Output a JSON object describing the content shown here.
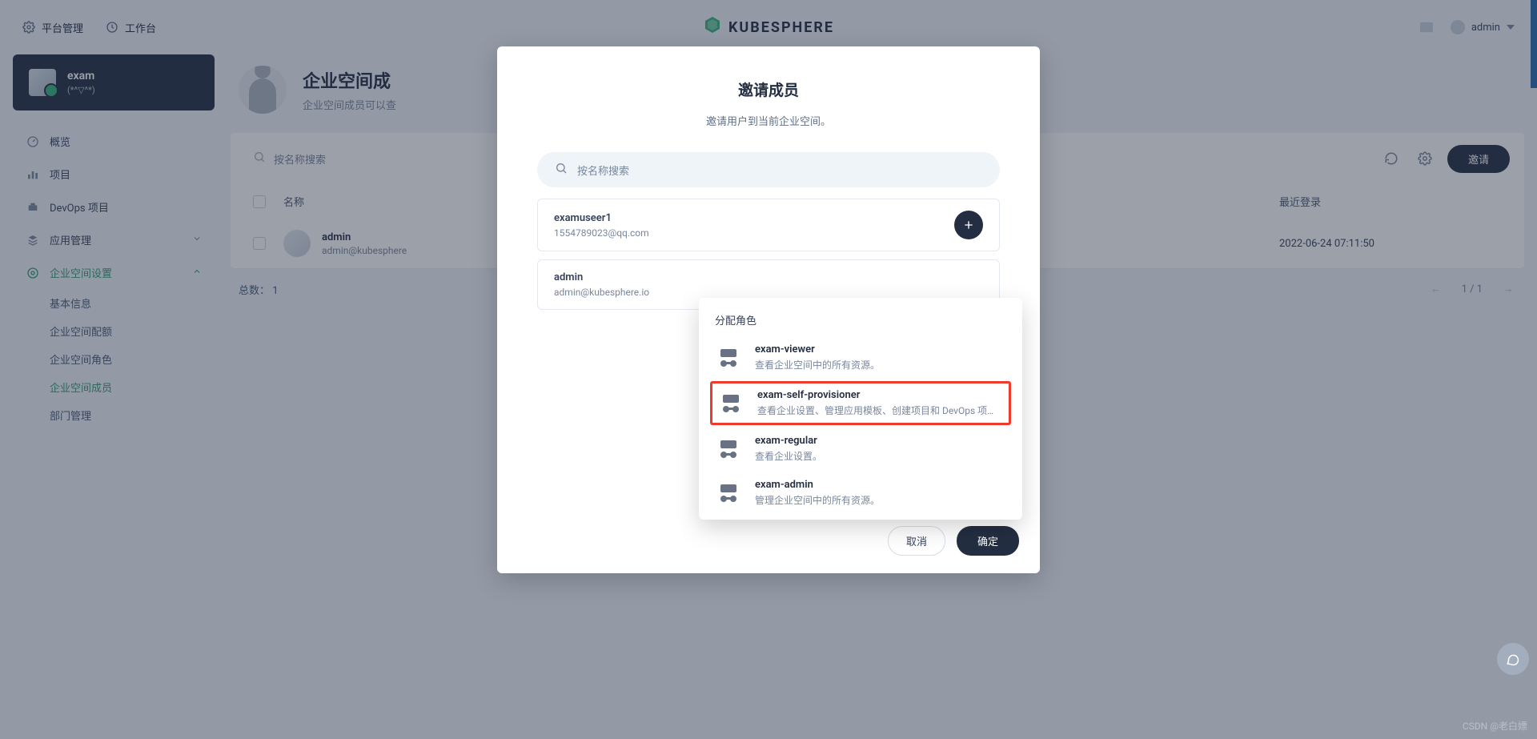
{
  "header": {
    "platform": "平台管理",
    "workbench": "工作台",
    "logo_text": "KUBESPHERE",
    "user": "admin"
  },
  "workspace": {
    "name": "exam",
    "desc": "(*^▽^*)"
  },
  "nav": {
    "overview": "概览",
    "projects": "项目",
    "devops": "DevOps 项目",
    "app_mgmt": "应用管理",
    "ws_settings": "企业空间设置",
    "sub": {
      "basic": "基本信息",
      "quota": "企业空间配额",
      "roles": "企业空间角色",
      "members": "企业空间成员",
      "dept": "部门管理"
    }
  },
  "page": {
    "title": "企业空间成",
    "subtitle": "企业空间成员可以查"
  },
  "toolbar": {
    "search_placeholder": "按名称搜索",
    "invite": "邀请"
  },
  "table": {
    "col_name": "名称",
    "col_last_login": "最近登录",
    "rows": [
      {
        "name": "admin",
        "email": "admin@kubesphere",
        "last_login": "2022-06-24 07:11:50"
      }
    ],
    "total_label": "总数：",
    "total": 1,
    "page_info": "1 / 1"
  },
  "modal": {
    "title": "邀请成员",
    "subtitle": "邀请用户到当前企业空间。",
    "search_placeholder": "按名称搜索",
    "users": [
      {
        "name": "examuseer1",
        "email": "1554789023@qq.com"
      },
      {
        "name": "admin",
        "email": "admin@kubesphere.io"
      }
    ],
    "role_popup_title": "分配角色",
    "roles": [
      {
        "name": "exam-viewer",
        "desc": "查看企业空间中的所有资源。"
      },
      {
        "name": "exam-self-provisioner",
        "desc": "查看企业设置、管理应用模板、创建项目和 DevOps 项…"
      },
      {
        "name": "exam-regular",
        "desc": "查看企业设置。"
      },
      {
        "name": "exam-admin",
        "desc": "管理企业空间中的所有资源。"
      }
    ],
    "cancel": "取消",
    "ok": "确定"
  },
  "watermark": "CSDN @老白嫖"
}
